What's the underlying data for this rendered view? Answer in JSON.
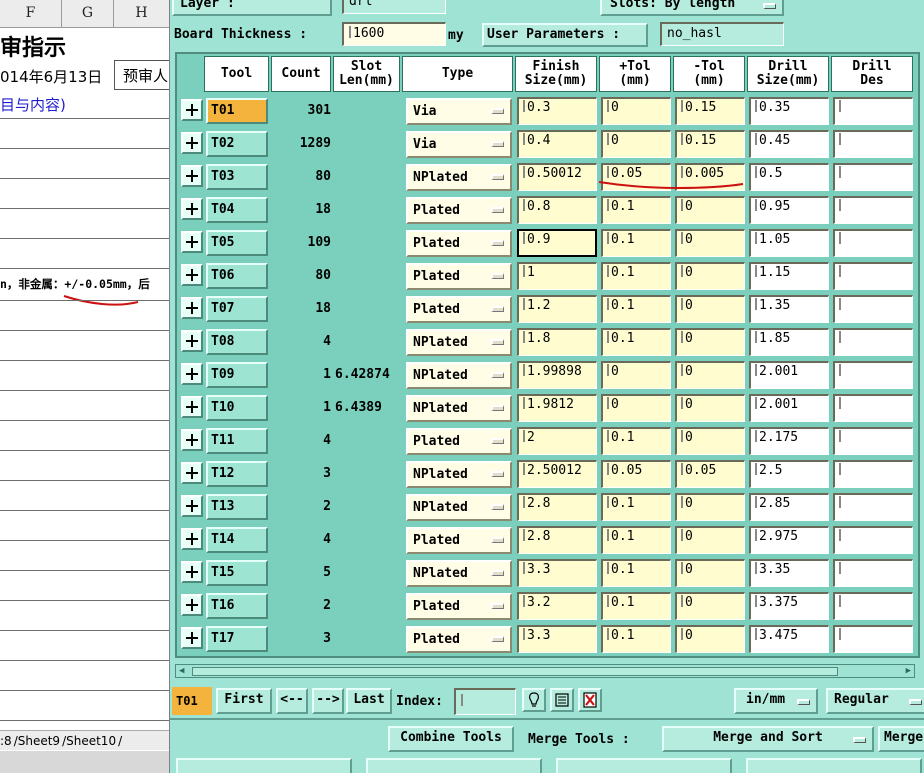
{
  "spreadsheet": {
    "columns": [
      "F",
      "G",
      "H"
    ],
    "title": "审指示",
    "date": "014年6月13日",
    "date_label": "预审人",
    "subtitle": "目与内容)",
    "note": "n，非金属：+/-0.05mm，后",
    "sheet_tabs": [
      ":8",
      "Sheet9",
      "Sheet10"
    ]
  },
  "app": {
    "layer_label": "Layer :",
    "layer_value": "drl",
    "slots_label": "Slots:",
    "slots_value": "By length",
    "board_thickness_label": "Board Thickness :",
    "board_thickness_value": "1600",
    "board_thickness_unit": "my",
    "user_parameters_label": "User Parameters :",
    "user_parameters_value": "no_hasl",
    "columns": {
      "tool": "Tool",
      "count": "Count",
      "slot_len_1": "Slot",
      "slot_len_2": "Len(mm)",
      "type": "Type",
      "finish_1": "Finish",
      "finish_2": "Size(mm)",
      "ptol_1": "+Tol",
      "ptol_2": "(mm)",
      "ntol_1": "-Tol",
      "ntol_2": "(mm)",
      "drill_1": "Drill",
      "drill_2": "Size(mm)",
      "des_1": "Drill",
      "des_2": "Des"
    },
    "rows": [
      {
        "tool": "T01",
        "count": "301",
        "slot_len": "",
        "type": "Via",
        "finish": "0.3",
        "plus_tol": "0",
        "minus_tol": "0.15",
        "drill": "0.35",
        "des": ""
      },
      {
        "tool": "T02",
        "count": "1289",
        "slot_len": "",
        "type": "Via",
        "finish": "0.4",
        "plus_tol": "0",
        "minus_tol": "0.15",
        "drill": "0.45",
        "des": ""
      },
      {
        "tool": "T03",
        "count": "80",
        "slot_len": "",
        "type": "NPlated",
        "finish": "0.50012",
        "plus_tol": "0.05",
        "minus_tol": "0.005",
        "drill": "0.5",
        "des": ""
      },
      {
        "tool": "T04",
        "count": "18",
        "slot_len": "",
        "type": "Plated",
        "finish": "0.8",
        "plus_tol": "0.1",
        "minus_tol": "0",
        "drill": "0.95",
        "des": ""
      },
      {
        "tool": "T05",
        "count": "109",
        "slot_len": "",
        "type": "Plated",
        "finish": "0.9",
        "plus_tol": "0.1",
        "minus_tol": "0",
        "drill": "1.05",
        "des": ""
      },
      {
        "tool": "T06",
        "count": "80",
        "slot_len": "",
        "type": "Plated",
        "finish": "1",
        "plus_tol": "0.1",
        "minus_tol": "0",
        "drill": "1.15",
        "des": ""
      },
      {
        "tool": "T07",
        "count": "18",
        "slot_len": "",
        "type": "Plated",
        "finish": "1.2",
        "plus_tol": "0.1",
        "minus_tol": "0",
        "drill": "1.35",
        "des": ""
      },
      {
        "tool": "T08",
        "count": "4",
        "slot_len": "",
        "type": "NPlated",
        "finish": "1.8",
        "plus_tol": "0.1",
        "minus_tol": "0",
        "drill": "1.85",
        "des": ""
      },
      {
        "tool": "T09",
        "count": "1",
        "slot_len": "6.42874",
        "type": "NPlated",
        "finish": "1.99898",
        "plus_tol": "0",
        "minus_tol": "0",
        "drill": "2.001",
        "des": ""
      },
      {
        "tool": "T10",
        "count": "1",
        "slot_len": "6.4389",
        "type": "NPlated",
        "finish": "1.9812",
        "plus_tol": "0",
        "minus_tol": "0",
        "drill": "2.001",
        "des": ""
      },
      {
        "tool": "T11",
        "count": "4",
        "slot_len": "",
        "type": "Plated",
        "finish": "2",
        "plus_tol": "0.1",
        "minus_tol": "0",
        "drill": "2.175",
        "des": ""
      },
      {
        "tool": "T12",
        "count": "3",
        "slot_len": "",
        "type": "NPlated",
        "finish": "2.50012",
        "plus_tol": "0.05",
        "minus_tol": "0.05",
        "drill": "2.5",
        "des": ""
      },
      {
        "tool": "T13",
        "count": "2",
        "slot_len": "",
        "type": "NPlated",
        "finish": "2.8",
        "plus_tol": "0.1",
        "minus_tol": "0",
        "drill": "2.85",
        "des": ""
      },
      {
        "tool": "T14",
        "count": "4",
        "slot_len": "",
        "type": "Plated",
        "finish": "2.8",
        "plus_tol": "0.1",
        "minus_tol": "0",
        "drill": "2.975",
        "des": ""
      },
      {
        "tool": "T15",
        "count": "5",
        "slot_len": "",
        "type": "NPlated",
        "finish": "3.3",
        "plus_tol": "0.1",
        "minus_tol": "0",
        "drill": "3.35",
        "des": ""
      },
      {
        "tool": "T16",
        "count": "2",
        "slot_len": "",
        "type": "Plated",
        "finish": "3.2",
        "plus_tol": "0.1",
        "minus_tol": "0",
        "drill": "3.375",
        "des": ""
      },
      {
        "tool": "T17",
        "count": "3",
        "slot_len": "",
        "type": "Plated",
        "finish": "3.3",
        "plus_tol": "0.1",
        "minus_tol": "0",
        "drill": "3.475",
        "des": ""
      }
    ],
    "selected_tool": "T01",
    "nav": {
      "current": "T01",
      "first": "First",
      "prev": "<--",
      "next": "-->",
      "last": "Last",
      "index_label": "Index:",
      "index_value": "",
      "units": "in/mm",
      "mode": "Regular"
    },
    "bottom": {
      "combine_tools": "Combine Tools",
      "merge_tools_label": "Merge Tools :",
      "merge_option": "Merge and Sort",
      "merge_cut": "Merge"
    },
    "colors": {
      "panel": "#9fe3d4",
      "grid": "#7ad0bd",
      "selected_tool": "#f4b33c",
      "field": "#fffdd0",
      "annotation": "#cc1111"
    },
    "icons": [
      "bulb-icon",
      "replace-icon",
      "delete-icon"
    ]
  }
}
